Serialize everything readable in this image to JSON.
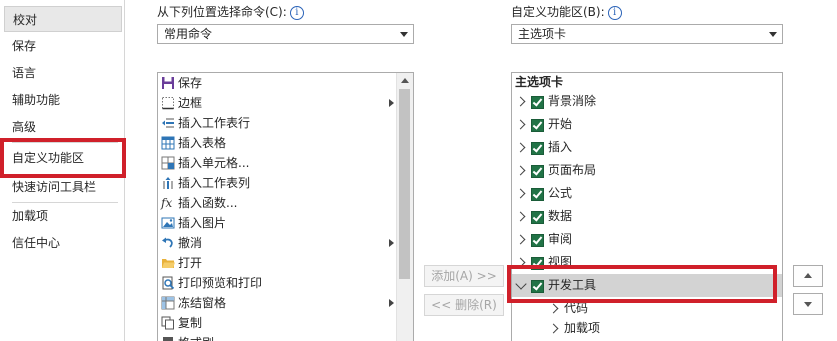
{
  "sidebar": {
    "items": [
      {
        "label": "校对"
      },
      {
        "label": "保存"
      },
      {
        "label": "语言"
      },
      {
        "label": "辅助功能"
      },
      {
        "label": "高级"
      },
      {
        "label": "自定义功能区"
      },
      {
        "label": "快速访问工具栏"
      },
      {
        "label": "加载项"
      },
      {
        "label": "信任中心"
      }
    ]
  },
  "choose_commands": {
    "label": "从下列位置选择命令(C):",
    "selected": "常用命令",
    "info_icon": "ⅰ"
  },
  "customize_ribbon": {
    "label": "自定义功能区(B):",
    "selected": "主选项卡",
    "info_icon": "ⅰ"
  },
  "commands": [
    {
      "label": "保存",
      "icon": "save-icon"
    },
    {
      "label": "边框",
      "icon": "border-icon",
      "submenu": true
    },
    {
      "label": "插入工作表行",
      "icon": "insert-row-icon"
    },
    {
      "label": "插入表格",
      "icon": "table-icon"
    },
    {
      "label": "插入单元格...",
      "icon": "insert-cells-icon"
    },
    {
      "label": "插入工作表列",
      "icon": "insert-column-icon"
    },
    {
      "label": "插入函数...",
      "icon": "function-icon",
      "glyph": "fx"
    },
    {
      "label": "插入图片",
      "icon": "picture-icon"
    },
    {
      "label": "撤消",
      "icon": "undo-icon",
      "submenu": true
    },
    {
      "label": "打开",
      "icon": "open-folder-icon"
    },
    {
      "label": "打印预览和打印",
      "icon": "print-preview-icon"
    },
    {
      "label": "冻结窗格",
      "icon": "freeze-panes-icon",
      "submenu": true
    },
    {
      "label": "复制",
      "icon": "copy-icon"
    },
    {
      "label": "格式刷",
      "icon": "format-painter-icon"
    }
  ],
  "buttons": {
    "add": "添加(A) >>",
    "remove": "<< 删除(R)"
  },
  "tree": {
    "header": "主选项卡",
    "tabs": [
      {
        "label": "背景消除",
        "checked": true
      },
      {
        "label": "开始",
        "checked": true
      },
      {
        "label": "插入",
        "checked": true
      },
      {
        "label": "页面布局",
        "checked": true
      },
      {
        "label": "公式",
        "checked": true
      },
      {
        "label": "数据",
        "checked": true
      },
      {
        "label": "审阅",
        "checked": true
      },
      {
        "label": "视图",
        "checked": true
      },
      {
        "label": "开发工具",
        "checked": true,
        "expanded": true,
        "highlighted": true
      }
    ],
    "groups": [
      {
        "label": "代码"
      },
      {
        "label": "加载项"
      }
    ]
  },
  "colors": {
    "highlight_red": "#d0202a",
    "check_green": "#217346",
    "info_blue": "#2b63b8"
  }
}
